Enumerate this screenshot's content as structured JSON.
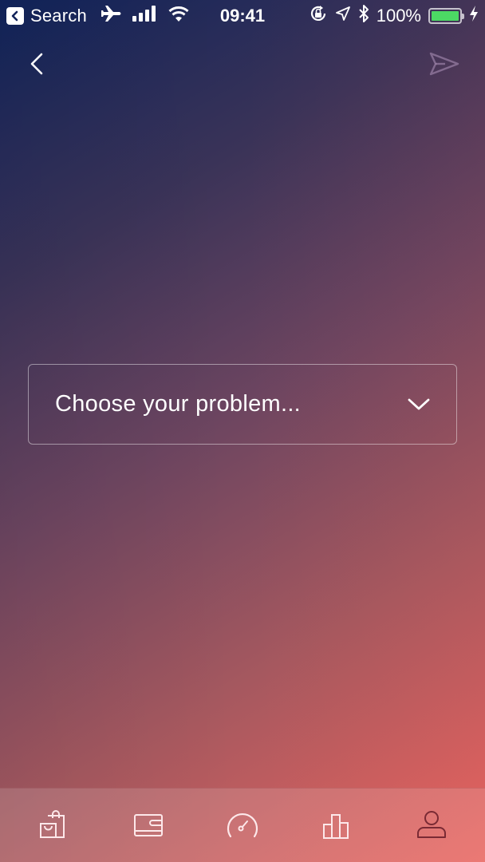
{
  "status_bar": {
    "back_app_label": "Search",
    "time": "09:41",
    "battery_percent": "100%",
    "battery_level": 1.0,
    "icons": [
      "airplane-mode-icon",
      "signal-icon",
      "wifi-icon",
      "orientation-lock-icon",
      "location-icon",
      "bluetooth-icon",
      "battery-icon",
      "charging-icon"
    ]
  },
  "nav": {
    "back_icon": "chevron-left-icon",
    "send_icon": "send-icon"
  },
  "dropdown": {
    "placeholder": "Choose your problem...",
    "icon": "chevron-down-icon"
  },
  "tab_bar": {
    "tabs": [
      {
        "name": "shop",
        "icon": "shopping-bags-icon",
        "active": false
      },
      {
        "name": "wallet",
        "icon": "wallet-icon",
        "active": false
      },
      {
        "name": "dashboard",
        "icon": "speedometer-icon",
        "active": false
      },
      {
        "name": "stats",
        "icon": "bar-chart-icon",
        "active": false
      },
      {
        "name": "profile",
        "icon": "user-icon",
        "active": true
      }
    ]
  },
  "colors": {
    "gradient_start": "#10235a",
    "gradient_end": "#e8645f",
    "icon_inactive": "#ffffff",
    "icon_active": "#7a2a34",
    "battery_fill": "#4cd964"
  }
}
